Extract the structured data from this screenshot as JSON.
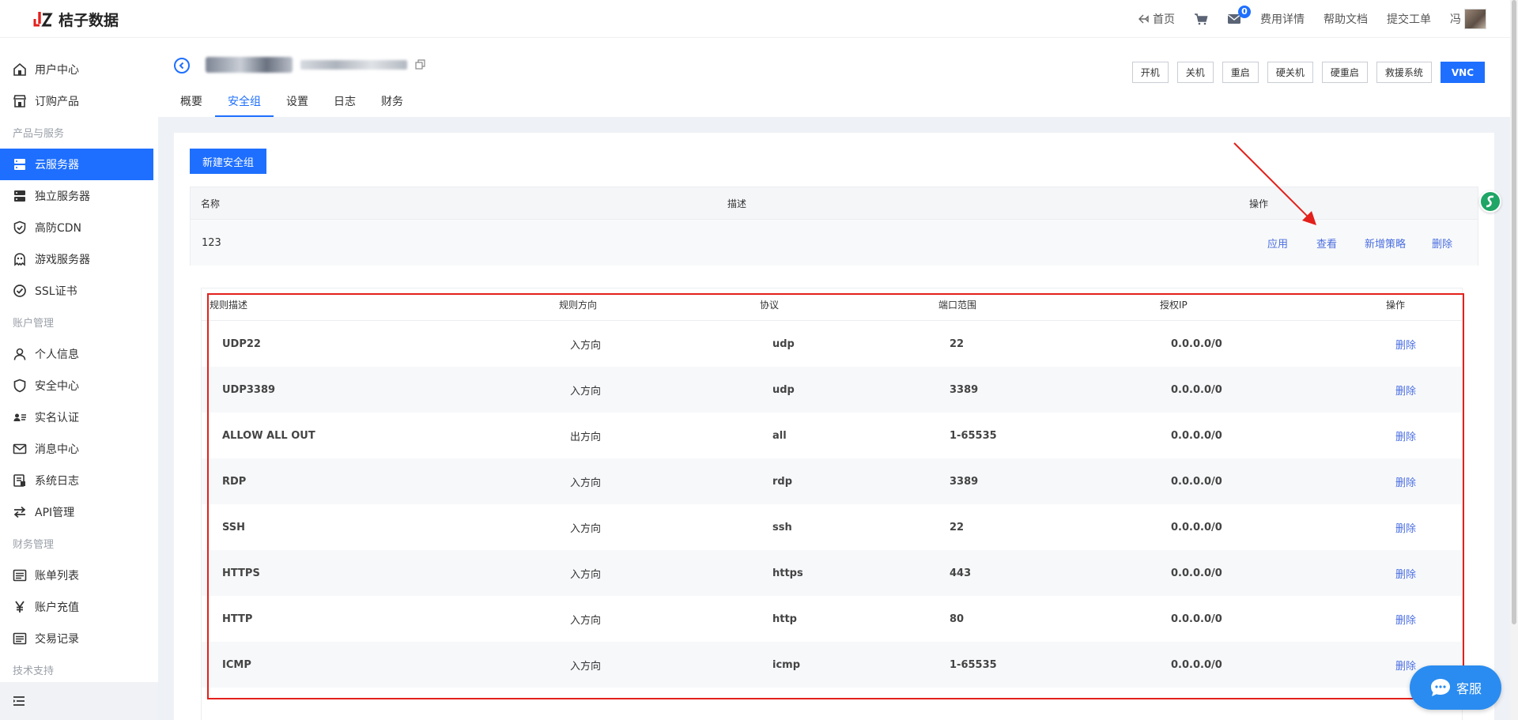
{
  "brand": {
    "name": "桔子数据"
  },
  "topnav": {
    "home": "首页",
    "cart": "",
    "mail_badge": "0",
    "fees": "费用详情",
    "help": "帮助文档",
    "ticket": "提交工单",
    "user": "冯"
  },
  "sidebar": {
    "items": [
      {
        "label": "用户中心",
        "icon": "home-icon"
      },
      {
        "label": "订购产品",
        "icon": "store-icon"
      },
      {
        "label": "云服务器",
        "icon": "server-icon"
      },
      {
        "label": "独立服务器",
        "icon": "server-icon"
      },
      {
        "label": "高防CDN",
        "icon": "shield-check-icon"
      },
      {
        "label": "游戏服务器",
        "icon": "ghost-icon"
      },
      {
        "label": "SSL证书",
        "icon": "check-circle-icon"
      },
      {
        "label": "个人信息",
        "icon": "user-icon"
      },
      {
        "label": "安全中心",
        "icon": "shield-icon"
      },
      {
        "label": "实名认证",
        "icon": "id-card-icon"
      },
      {
        "label": "消息中心",
        "icon": "mail-icon"
      },
      {
        "label": "系统日志",
        "icon": "log-icon"
      },
      {
        "label": "API管理",
        "icon": "swap-icon"
      },
      {
        "label": "账单列表",
        "icon": "list-icon"
      },
      {
        "label": "账户充值",
        "icon": "yen-icon"
      },
      {
        "label": "交易记录",
        "icon": "list-icon"
      }
    ],
    "groups": [
      "产品与服务",
      "账户管理",
      "财务管理",
      "技术支持"
    ]
  },
  "header": {
    "tabs": [
      "概要",
      "安全组",
      "设置",
      "日志",
      "财务"
    ],
    "active_tab": "安全组",
    "buttons": [
      "开机",
      "关机",
      "重启",
      "硬关机",
      "硬重启",
      "救援系统",
      "VNC"
    ]
  },
  "security_groups": {
    "new_button": "新建安全组",
    "columns": [
      "名称",
      "描述",
      "操作"
    ],
    "rows": [
      {
        "name": "123",
        "desc": "",
        "actions": [
          "应用",
          "查看",
          "新增策略",
          "删除"
        ]
      }
    ]
  },
  "rules": {
    "columns": [
      "规则描述",
      "规则方向",
      "协议",
      "端口范围",
      "授权IP",
      "操作"
    ],
    "rows": [
      {
        "desc": "UDP22",
        "direction": "入方向",
        "protocol": "udp",
        "port": "22",
        "ip": "0.0.0.0/0",
        "action": "删除"
      },
      {
        "desc": "UDP3389",
        "direction": "入方向",
        "protocol": "udp",
        "port": "3389",
        "ip": "0.0.0.0/0",
        "action": "删除"
      },
      {
        "desc": "ALLOW ALL OUT",
        "direction": "出方向",
        "protocol": "all",
        "port": "1-65535",
        "ip": "0.0.0.0/0",
        "action": "删除"
      },
      {
        "desc": "RDP",
        "direction": "入方向",
        "protocol": "rdp",
        "port": "3389",
        "ip": "0.0.0.0/0",
        "action": "删除"
      },
      {
        "desc": "SSH",
        "direction": "入方向",
        "protocol": "ssh",
        "port": "22",
        "ip": "0.0.0.0/0",
        "action": "删除"
      },
      {
        "desc": "HTTPS",
        "direction": "入方向",
        "protocol": "https",
        "port": "443",
        "ip": "0.0.0.0/0",
        "action": "删除"
      },
      {
        "desc": "HTTP",
        "direction": "入方向",
        "protocol": "http",
        "port": "80",
        "ip": "0.0.0.0/0",
        "action": "删除"
      },
      {
        "desc": "ICMP",
        "direction": "入方向",
        "protocol": "icmp",
        "port": "1-65535",
        "ip": "0.0.0.0/0",
        "action": "删除"
      }
    ]
  },
  "support": {
    "label": "客服"
  },
  "colors": {
    "accent": "#1e6fff",
    "link": "#4b6fe0",
    "annotation": "#e3201b"
  }
}
